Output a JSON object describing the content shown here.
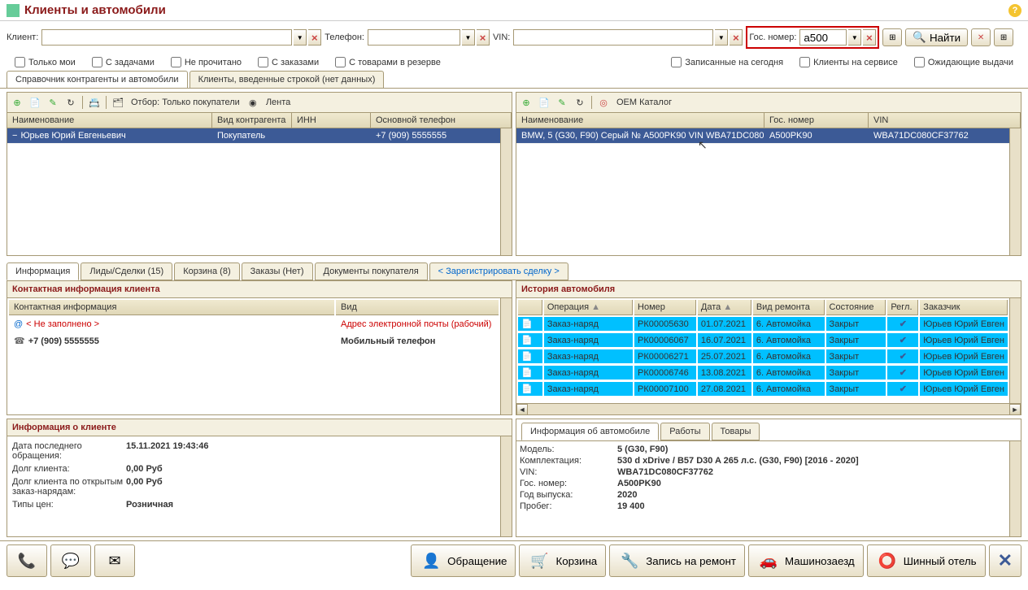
{
  "title": "Клиенты и автомобили",
  "searchBar": {
    "clientLabel": "Клиент:",
    "phoneLabel": "Телефон:",
    "vinLabel": "VIN:",
    "gosNomerLabel": "Гос. номер:",
    "gosNomerValue": "a500",
    "findLabel": "Найти"
  },
  "checkboxes": {
    "onlyMine": "Только мои",
    "withTasks": "С задачами",
    "unread": "Не прочитано",
    "withOrders": "С заказами",
    "withReserved": "С товарами в резерве",
    "bookedToday": "Записанные на сегодня",
    "inService": "Клиенты на сервисе",
    "awaitingDelivery": "Ожидающие выдачи"
  },
  "mainTabs": {
    "tab1": "Справочник контрагенты и автомобили",
    "tab2": "Клиенты, введенные строкой (нет данных)"
  },
  "clientsToolbar": {
    "filterLabel": "Отбор: Только покупатели",
    "lentaLabel": "Лента"
  },
  "clientsGrid": {
    "cols": {
      "name": "Наименование",
      "type": "Вид контрагента",
      "inn": "ИНН",
      "phone": "Основной телефон"
    },
    "widths": {
      "name": 252,
      "type": 98,
      "inn": 97,
      "phone": 160
    },
    "row": {
      "name": "Юрьев Юрий Евгеньевич",
      "type": "Покупатель",
      "inn": "",
      "phone": "+7 (909) 5555555"
    }
  },
  "carsToolbar": {
    "oemLabel": "ОЕМ Каталог"
  },
  "carsGrid": {
    "cols": {
      "name": "Наименование",
      "gos": "Гос. номер",
      "vin": "VIN"
    },
    "widths": {
      "name": 305,
      "gos": 128,
      "vin": 160
    },
    "row": {
      "name": "BMW, 5 (G30, F90) Серый № A500PK90 VIN WBA71DC080C…",
      "gos": "A500PK90",
      "vin": "WBA71DC080CF37762"
    }
  },
  "detailTabs": {
    "info": "Информация",
    "leads": "Лиды/Сделки (15)",
    "cart": "Корзина (8)",
    "orders": "Заказы (Нет)",
    "docs": "Документы покупателя",
    "register": "<  Зарегистрировать сделку  >"
  },
  "contactPanel": {
    "header": "Контактная информация клиента",
    "colContact": "Контактная информация",
    "colType": "Вид",
    "emailValue": "< Не заполнено >",
    "emailType": "Адрес электронной почты (рабочий)",
    "phoneValue": "+7 (909) 5555555",
    "phoneType": "Мобильный телефон"
  },
  "historyPanel": {
    "header": "История автомобиля",
    "cols": {
      "op": "Операция",
      "num": "Номер",
      "date": "Дата",
      "kind": "Вид ремонта",
      "state": "Состояние",
      "regl": "Регл.",
      "customer": "Заказчик"
    },
    "rows": [
      {
        "op": "Заказ-наряд",
        "num": "РК00005630",
        "date": "01.07.2021",
        "kind": "6. Автомойка",
        "state": "Закрыт",
        "customer": "Юрьев Юрий Евген"
      },
      {
        "op": "Заказ-наряд",
        "num": "РК00006067",
        "date": "16.07.2021",
        "kind": "6. Автомойка",
        "state": "Закрыт",
        "customer": "Юрьев Юрий Евген"
      },
      {
        "op": "Заказ-наряд",
        "num": "РК00006271",
        "date": "25.07.2021",
        "kind": "6. Автомойка",
        "state": "Закрыт",
        "customer": "Юрьев Юрий Евген"
      },
      {
        "op": "Заказ-наряд",
        "num": "РК00006746",
        "date": "13.08.2021",
        "kind": "6. Автомойка",
        "state": "Закрыт",
        "customer": "Юрьев Юрий Евген"
      },
      {
        "op": "Заказ-наряд",
        "num": "РК00007100",
        "date": "27.08.2021",
        "kind": "6. Автомойка",
        "state": "Закрыт",
        "customer": "Юрьев Юрий Евген"
      }
    ]
  },
  "clientInfo": {
    "header": "Информация о клиенте",
    "lastContactLabel": "Дата последнего обращения:",
    "lastContactValue": "15.11.2021 19:43:46",
    "debtLabel": "Долг клиента:",
    "debtValue": "0,00 Руб",
    "openDebtLabel": "Долг клиента по открытым заказ-нарядам:",
    "openDebtValue": "0,00 Руб",
    "priceTypeLabel": "Типы цен:",
    "priceTypeValue": "Розничная"
  },
  "carInfo": {
    "tabs": {
      "info": "Информация об автомобиле",
      "works": "Работы",
      "goods": "Товары"
    },
    "modelLabel": "Модель:",
    "modelValue": "5 (G30, F90)",
    "complLabel": "Комплектация:",
    "complValue": "530 d xDrive / B57 D30 A 265 л.с. (G30, F90) [2016 - 2020]",
    "vinLabel": "VIN:",
    "vinValue": "WBA71DC080CF37762",
    "gosLabel": "Гос. номер:",
    "gosValue": "A500PK90",
    "yearLabel": "Год выпуска:",
    "yearValue": "2020",
    "kmLabel": "Пробег:",
    "kmValue": "19 400"
  },
  "bottomBar": {
    "appeal": "Обращение",
    "cart": "Корзина",
    "repair": "Запись на ремонт",
    "carEntry": "Машинозаезд",
    "tire": "Шинный отель"
  }
}
